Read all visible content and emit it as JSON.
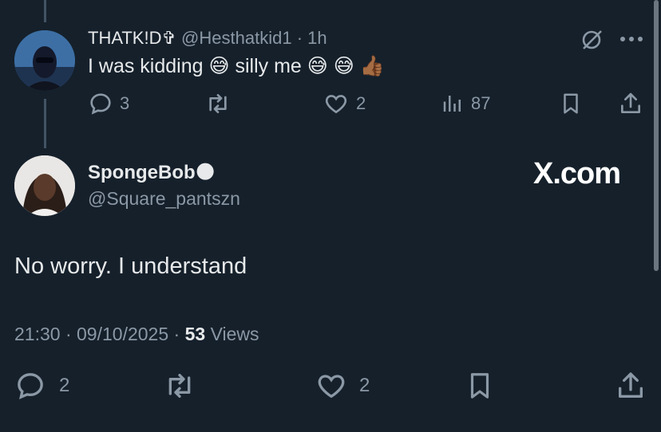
{
  "reply_tweet": {
    "display_name": "THATK!D✞",
    "handle": "@Hesthatkid1",
    "separator": "·",
    "time": "1h",
    "text": "I was kidding 😅  silly me 😅 😅 👍🏾",
    "replies": "3",
    "likes": "2",
    "views": "87"
  },
  "main_tweet": {
    "display_name": "SpongeBob",
    "name_emoji": "🌑",
    "handle": "@Square_pantszn",
    "brand": "X.com",
    "text": "No worry. I understand",
    "time": "21:30",
    "sep1": "·",
    "date": "09/10/2025",
    "sep2": "·",
    "views_count": "53",
    "views_label": "Views",
    "replies": "2",
    "likes": "2"
  },
  "colors": {
    "background": "#15202b",
    "text": "#e7e9ea",
    "muted": "#8b98a5",
    "thread_line": "#425364"
  }
}
